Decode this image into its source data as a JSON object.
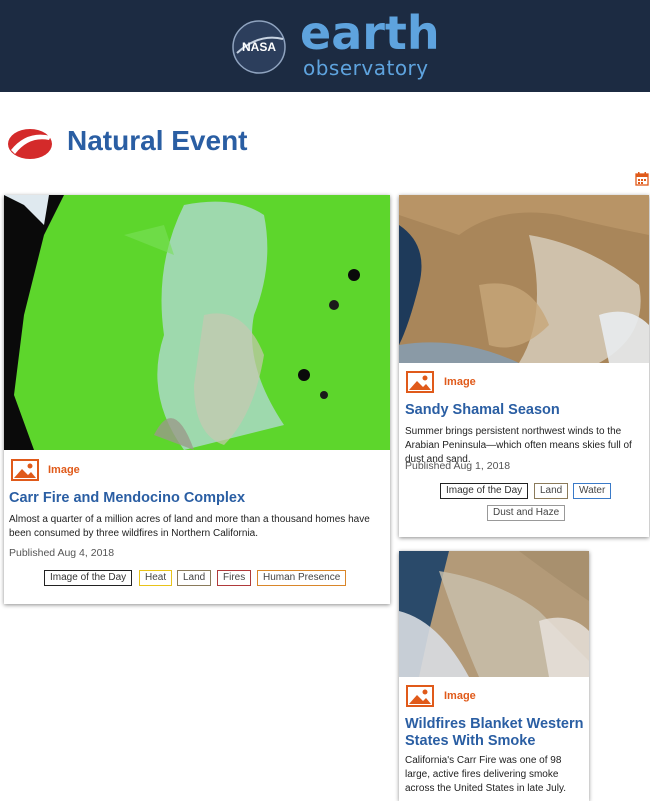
{
  "header": {
    "nasa_text": "NASA",
    "logo_word": "earth",
    "logo_sub": "observatory"
  },
  "page": {
    "title": "Natural Event",
    "calendar_icon": "calendar-icon"
  },
  "colors": {
    "header_bg": "#1c2b42",
    "title_blue": "#2a5ea3",
    "accent_orange": "#e05a1a",
    "tag_iotd": "#222222",
    "tag_heat": "#e8c31a",
    "tag_land": "#8a7a5a",
    "tag_fires": "#b03a3a",
    "tag_human": "#d9862a",
    "tag_water": "#3a7ac8",
    "tag_dust": "#999999"
  },
  "cards": [
    {
      "type": "Image",
      "title": "Carr Fire and Mendocino Complex",
      "description": "Almost a quarter of a million acres of land and more than a thousand homes have been consumed by three wildfires in Northern California.",
      "date": "Published Aug 4, 2018",
      "tags": [
        "Image of the Day",
        "Heat",
        "Land",
        "Fires",
        "Human Presence"
      ]
    },
    {
      "type": "Image",
      "title": "Sandy Shamal Season",
      "description": "Summer brings persistent northwest winds to the Arabian Peninsula—which often means skies full of dust and sand.",
      "date": "Published Aug 1, 2018",
      "tags": [
        "Image of the Day",
        "Land",
        "Water",
        "Dust and Haze"
      ]
    },
    {
      "type": "Image",
      "title": "Wildfires Blanket Western States With Smoke",
      "description": "California's Carr Fire was one of 98 large, active fires delivering smoke across the United States in late July."
    }
  ]
}
